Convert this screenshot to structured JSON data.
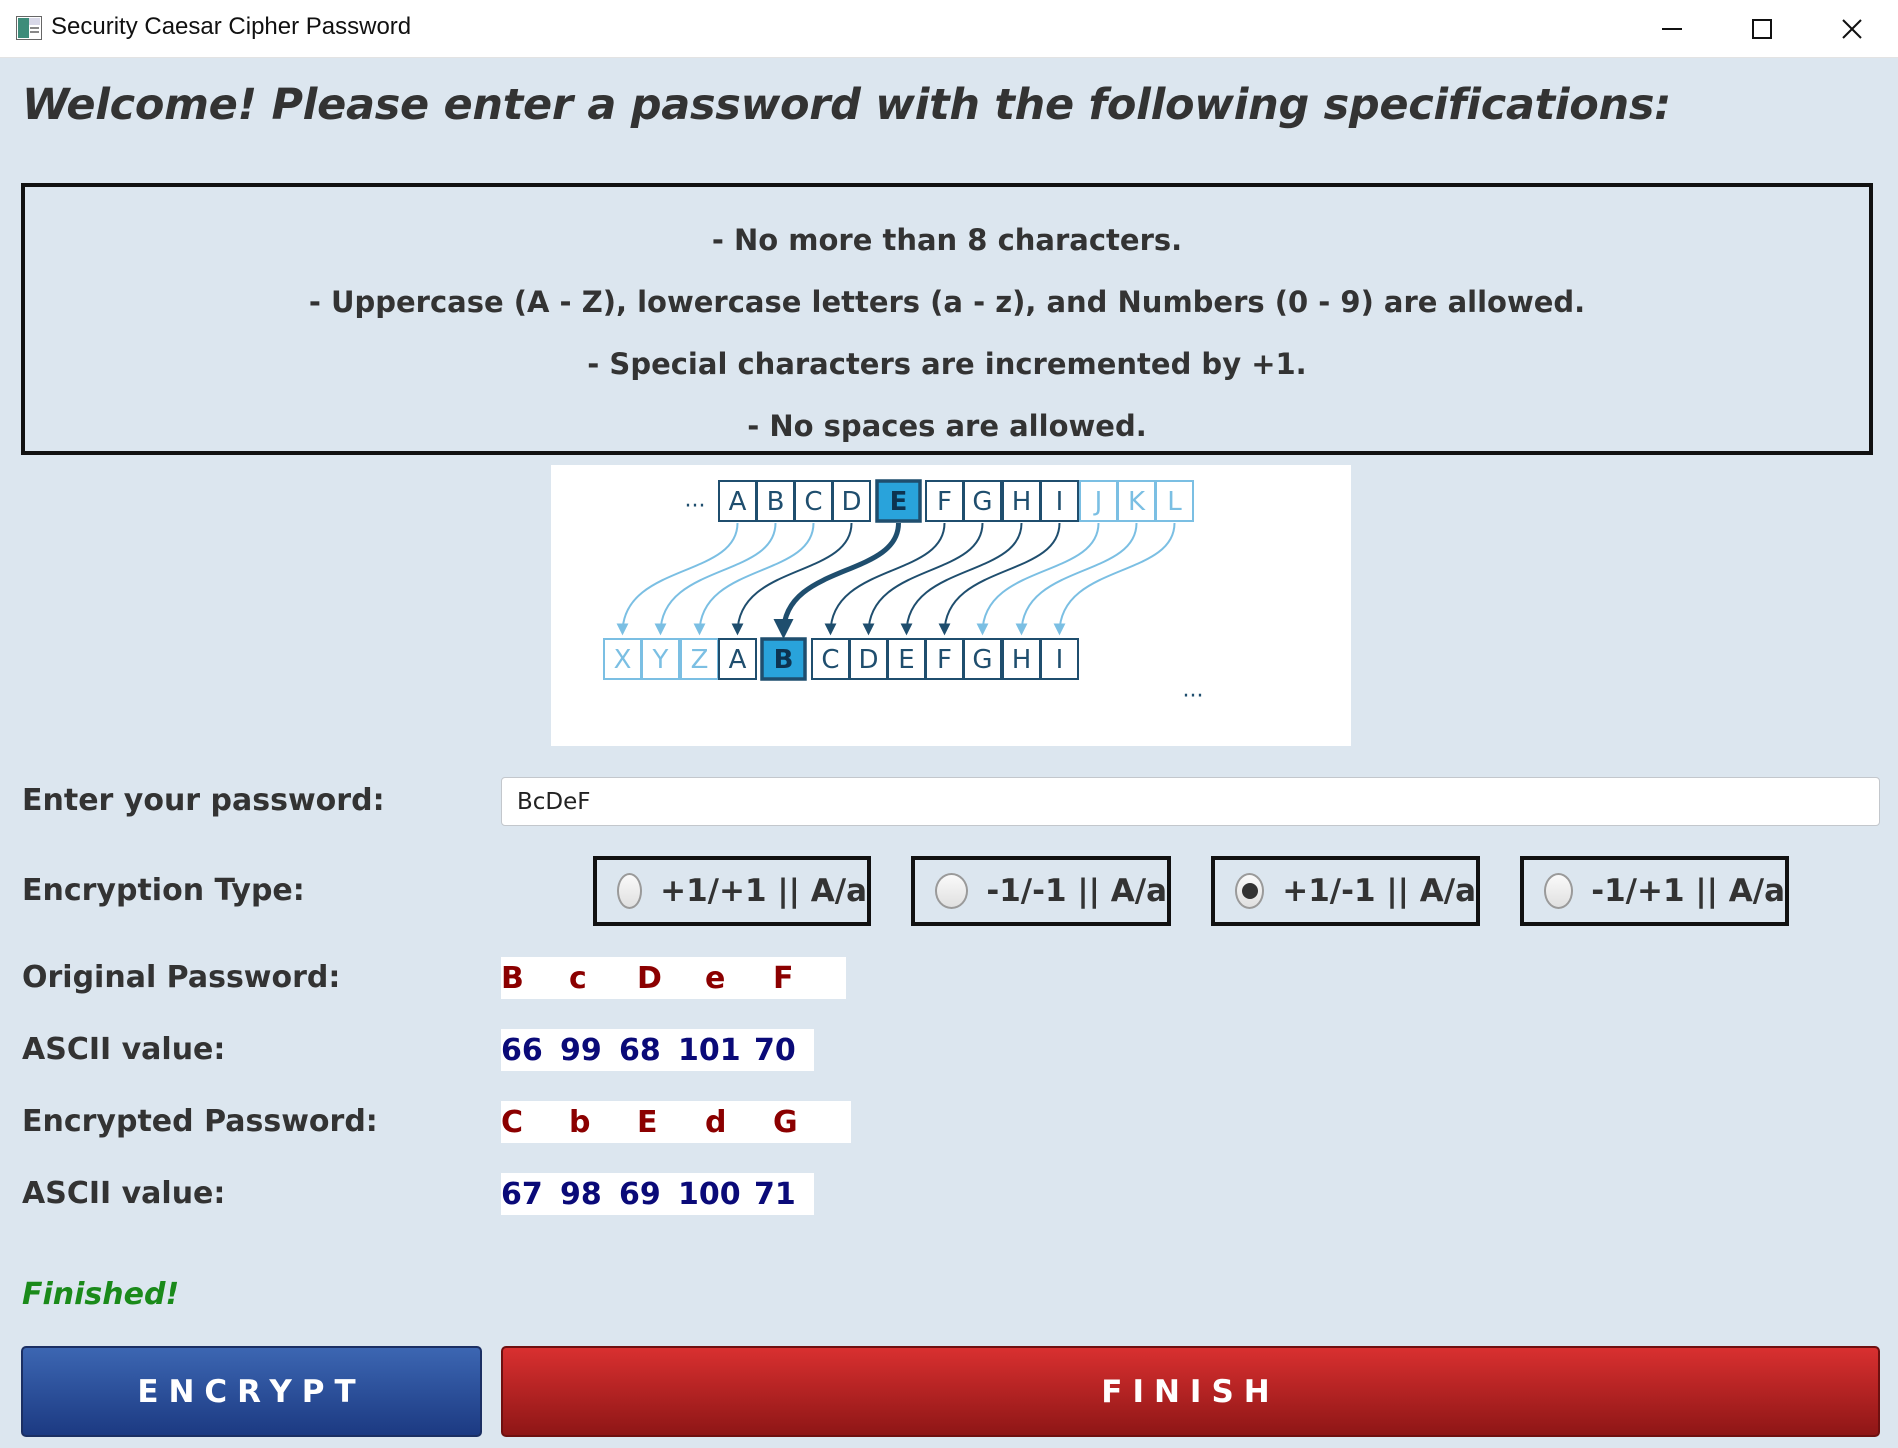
{
  "window": {
    "title": "Security Caesar Cipher Password",
    "controls": {
      "minimize": "minimize-icon",
      "maximize": "maximize-icon",
      "close": "close-icon"
    }
  },
  "welcome": "Welcome! Please enter a password with the following specifications:",
  "specs": [
    "- No more than 8 characters.",
    "- Uppercase (A - Z), lowercase letters (a - z), and Numbers (0 - 9) are allowed.",
    "- Special characters are incremented by +1.",
    "- No spaces are allowed."
  ],
  "cipher": {
    "top_row": [
      "A",
      "B",
      "C",
      "D",
      "E",
      "F",
      "G",
      "H",
      "I",
      "J",
      "K",
      "L"
    ],
    "bottom_row": [
      "X",
      "Y",
      "Z",
      "A",
      "B",
      "C",
      "D",
      "E",
      "F",
      "G",
      "H",
      "I"
    ],
    "highlight_top": "E",
    "highlight_bottom": "B",
    "ellipsis": "···"
  },
  "form": {
    "password_label": "Enter your password:",
    "password_value": "BcDeF",
    "encryption_label": "Encryption Type:",
    "options": [
      {
        "label": "+1/+1 || A/a",
        "selected": false
      },
      {
        "label": "-1/-1 || A/a",
        "selected": false
      },
      {
        "label": "+1/-1 || A/a",
        "selected": true
      },
      {
        "label": "-1/+1 || A/a",
        "selected": false
      }
    ]
  },
  "results": {
    "original_label": "Original Password:",
    "original_chars": [
      "B",
      "c",
      "D",
      "e",
      "F"
    ],
    "ascii_label_1": "ASCII value:",
    "original_ascii": [
      "66",
      "99",
      "68",
      "101",
      "70"
    ],
    "encrypted_label": "Encrypted Password:",
    "encrypted_chars": [
      "C",
      "b",
      "E",
      "d",
      "G"
    ],
    "ascii_label_2": "ASCII value:",
    "encrypted_ascii": [
      "67",
      "98",
      "69",
      "100",
      "71"
    ]
  },
  "status": "Finished!",
  "buttons": {
    "encrypt": "ENCRYPT",
    "finish": "FINISH"
  },
  "colors": {
    "background": "#dce6ef",
    "encrypt_button": "#2a4d99",
    "finish_button": "#b32222",
    "char_red": "#8b0000",
    "ascii_blue": "#0a0a78",
    "status_green": "#1a8a1a",
    "cipher_dark": "#1f4e6e",
    "cipher_light": "#7bbfe3",
    "cipher_highlight": "#29a3db"
  }
}
